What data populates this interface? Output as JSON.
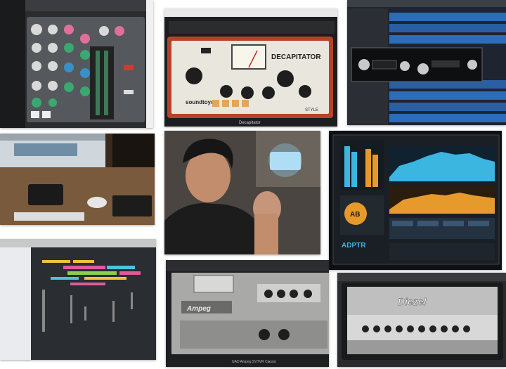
{
  "collage": {
    "tiles": [
      {
        "name": "console-eq-plugin-screen"
      },
      {
        "name": "decapitator-plugin-screen"
      },
      {
        "name": "daw-tracks-with-plugin"
      },
      {
        "name": "studio-desk-photo"
      },
      {
        "name": "producer-portrait-photo"
      },
      {
        "name": "adptr-plugin-screen"
      },
      {
        "name": "daw-arrangement-screen"
      },
      {
        "name": "ampeg-plugin-screen"
      },
      {
        "name": "diezel-amp-plugin-screen"
      }
    ]
  },
  "decapitator": {
    "window_title": "Decapitator",
    "plugin_name": "DECAPITATOR",
    "brand": "soundtoys",
    "style_label": "STYLE"
  },
  "adptr": {
    "ab_label": "AB",
    "brand": "ADPTR"
  },
  "ampeg": {
    "brand": "Ampeg",
    "caption": "UAD Ampeg SVTVR Classic"
  },
  "diezel": {
    "brand": "Diezel"
  },
  "colors": {
    "decapitator_frame": "#b5432a",
    "adptr_blue": "#3ab6e0",
    "adptr_orange": "#e79a2c",
    "eq_green": "#3aa870",
    "eq_pink": "#e0709a"
  }
}
